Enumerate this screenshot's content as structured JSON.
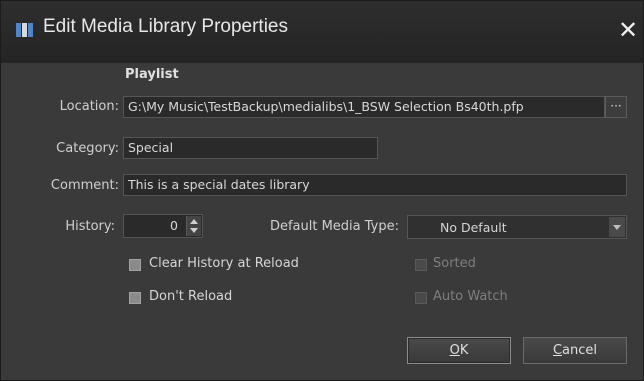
{
  "window": {
    "title": "Edit Media Library Properties",
    "close_glyph": "✕",
    "title_icon": "media-library-icon"
  },
  "section": {
    "title": "Playlist"
  },
  "fields": {
    "location_label": "Location:",
    "location_value": "G:\\My Music\\TestBackup\\medialibs\\1_BSW Selection Bs40th.pfp",
    "browse_label": "···",
    "category_label": "Category:",
    "category_value": "Special",
    "comment_label": "Comment:",
    "comment_value": "This is a special dates library",
    "history_label": "History:",
    "history_value": "0",
    "media_type_label": "Default Media Type:",
    "media_type_value": "No Default"
  },
  "options": {
    "clear_history": "Clear History at Reload",
    "dont_reload": "Don't Reload",
    "sorted": "Sorted",
    "auto_watch": "Auto Watch"
  },
  "buttons": {
    "ok_first": "O",
    "ok_rest": "K",
    "cancel_first": "C",
    "cancel_rest": "ancel"
  },
  "colors": {
    "background": "#3a3a3a",
    "titlebar": "#262626",
    "field": "#2a2a2a"
  }
}
